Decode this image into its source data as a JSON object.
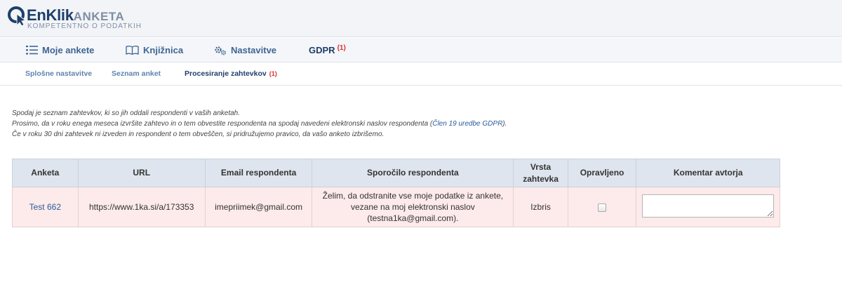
{
  "brand": {
    "name": "EnKlik",
    "suffix": "ANKETA",
    "tagline": "KOMPETENTNO O PODATKIH"
  },
  "mainnav": {
    "items": [
      {
        "label": "Moje ankete",
        "icon": "list-icon"
      },
      {
        "label": "Knjižnica",
        "icon": "book-icon"
      },
      {
        "label": "Nastavitve",
        "icon": "gears-icon"
      },
      {
        "label": "GDPR",
        "badge": "(1)"
      }
    ]
  },
  "subnav": {
    "items": [
      {
        "label": "Splošne nastavitve"
      },
      {
        "label": "Seznam anket"
      },
      {
        "label": "Procesiranje zahtevkov",
        "badge": "(1)"
      }
    ]
  },
  "intro": {
    "line1": "Spodaj je seznam zahtevkov, ki so jih oddali respondenti v vaših anketah.",
    "line2_before": "Prosimo, da v roku enega meseca izvršite zahtevo in o tem obvestite respondenta na spodaj navedeni elektronski naslov respondenta (",
    "line2_link": "Člen 19 uredbe GDPR",
    "line2_after": ").",
    "line3": "Če v roku 30 dni zahtevek ni izveden in respondent o tem obveščen, si pridružujemo pravico, da vašo anketo izbrišemo."
  },
  "table": {
    "headers": [
      "Anketa",
      "URL",
      "Email respondenta",
      "Sporočilo respondenta",
      "Vrsta zahtevka",
      "Opravljeno",
      "Komentar avtorja"
    ],
    "rows": [
      {
        "anketa": "Test 662",
        "url": "https://www.1ka.si/a/173353",
        "email": "imepriimek@gmail.com",
        "message": "Želim, da odstranite vse moje podatke iz ankete, vezane na moj elektronski naslov (testna1ka@gmail.com).",
        "type": "Izbris",
        "done": false,
        "comment": ""
      }
    ]
  },
  "colors": {
    "header_bg": "#f2f4f7",
    "brand_blue": "#1e3f6a",
    "link_blue": "#2a5b9a",
    "badge_red": "#d9302c",
    "table_header_bg": "#dfe5ee",
    "row_bg": "#fdeaea"
  }
}
